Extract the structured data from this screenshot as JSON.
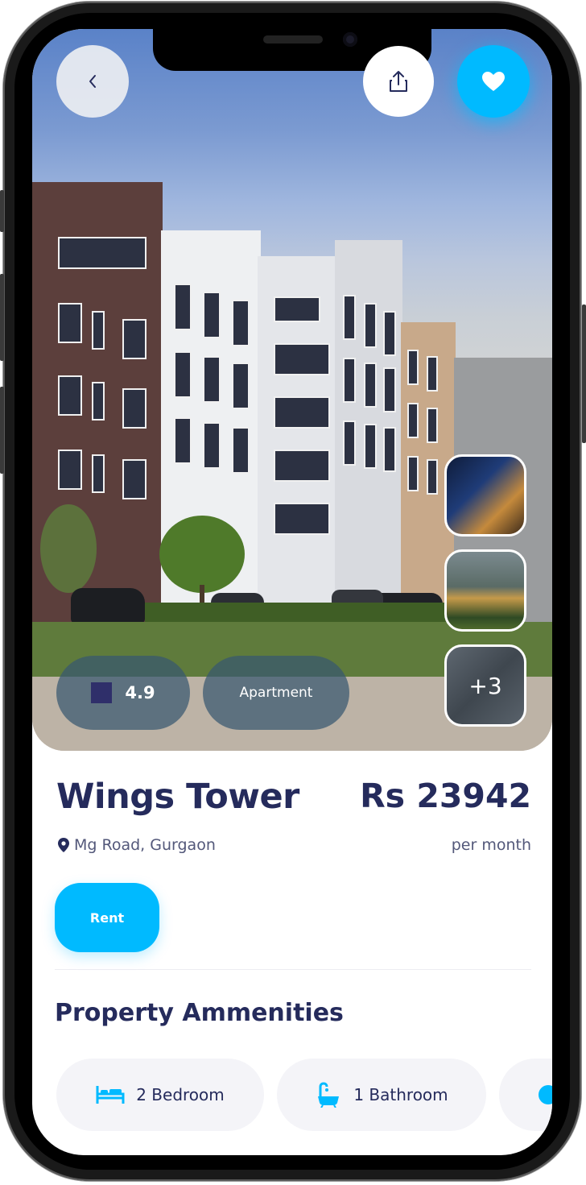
{
  "property": {
    "name": "Wings Tower",
    "price": "Rs 23942",
    "price_period": "per month",
    "location": "Mg Road, Gurgaon",
    "rating": "4.9",
    "type": "Apartment",
    "more_photos": "+3"
  },
  "actions": {
    "rent_label": "Rent"
  },
  "amenities": {
    "title": "Property Ammenities",
    "items": [
      {
        "label": "2 Bedroom",
        "icon": "bed-icon"
      },
      {
        "label": "1 Bathroom",
        "icon": "bathtub-icon"
      }
    ]
  },
  "colors": {
    "accent": "#00baff",
    "heading": "#252b5c",
    "muted": "#53587a"
  }
}
